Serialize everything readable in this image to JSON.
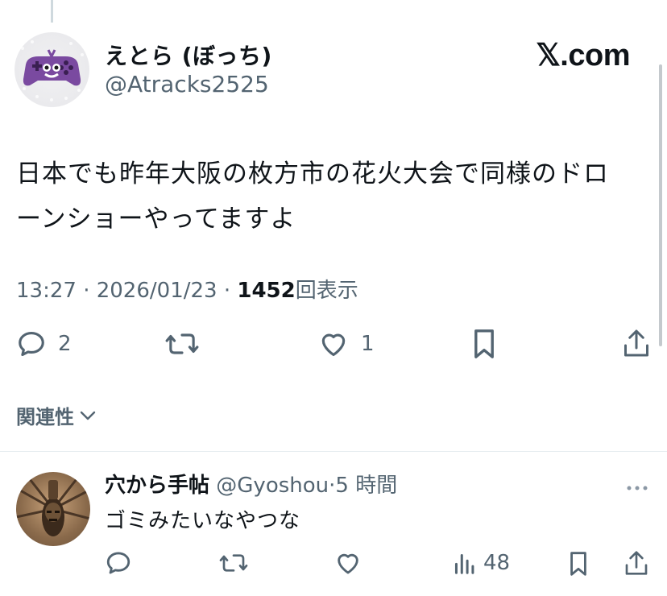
{
  "domain": "Computer-Use",
  "brand": {
    "text": "𝕏.com"
  },
  "tweet": {
    "author_name": "えとら (ぼっち)",
    "author_handle": "@Atracks2525",
    "text_line1": "日本でも昨年大阪の枚方市の花火大会で同様のドロ",
    "text_line2": "ーンショーやってますよ",
    "time": "13:27 · 2026/01/23 · ",
    "views_count": "1452",
    "views_label": "回表示",
    "actions": {
      "reply_count": "2",
      "retweet_count": "",
      "like_count": "1"
    }
  },
  "related": {
    "label": "関連性"
  },
  "reply": {
    "author_name": "穴から手帖",
    "author_handle": "@Gyoshou",
    "time": "5 時間",
    "text": "ゴミみたいなやつな",
    "views_count": "48"
  },
  "colors": {
    "text": "#0f1419",
    "secondary": "#536471",
    "divider": "#e6ecf0",
    "avatar_purple": "#7a4aa0"
  }
}
